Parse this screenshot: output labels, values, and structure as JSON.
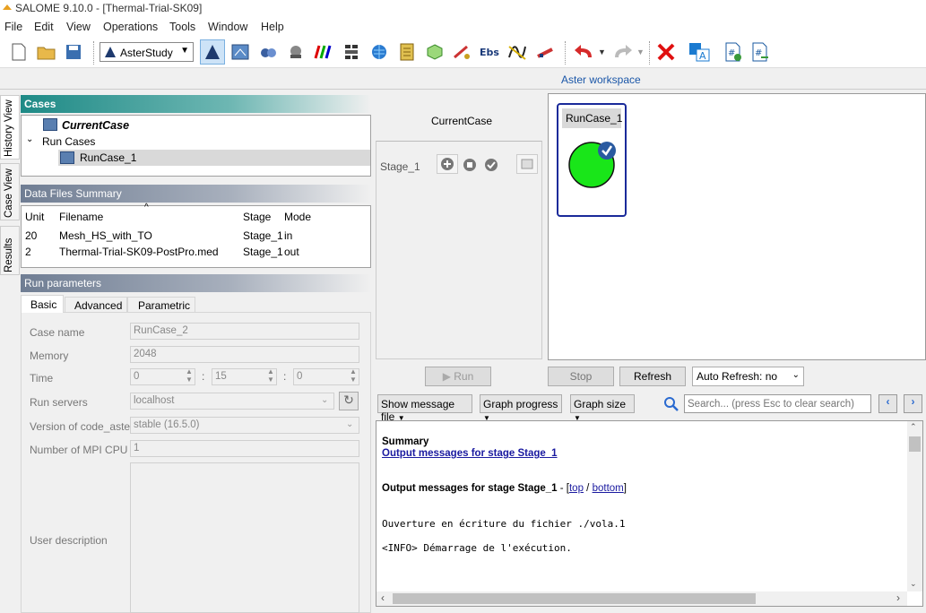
{
  "titlebar": {
    "title": "SALOME 9.10.0 - [Thermal-Trial-SK09]"
  },
  "menu": [
    "File",
    "Edit",
    "View",
    "Operations",
    "Tools",
    "Window",
    "Help"
  ],
  "toolbar": {
    "module": "AsterStudy"
  },
  "workspace_label": "Aster workspace",
  "vtabs": {
    "history": "History View",
    "case": "Case View",
    "results": "Results"
  },
  "cases": {
    "header": "Cases",
    "current": "CurrentCase",
    "run_cases": "Run Cases",
    "runcase": "RunCase_1"
  },
  "datafiles": {
    "header": "Data Files Summary",
    "columns": [
      "Unit",
      "Filename",
      "Stage",
      "Mode"
    ],
    "rows": [
      [
        "20",
        "Mesh_HS_with_TO",
        "Stage_1",
        "in"
      ],
      [
        "2",
        "Thermal-Trial-SK09-PostPro.med",
        "Stage_1",
        "out"
      ]
    ]
  },
  "runparams": {
    "header": "Run parameters",
    "tabs": [
      "Basic",
      "Advanced",
      "Parametric"
    ],
    "case_name_label": "Case name",
    "case_name": "RunCase_2",
    "memory_label": "Memory",
    "memory": "2048",
    "time_label": "Time",
    "time_h": "0",
    "time_m": "15",
    "time_s": "0",
    "servers_label": "Run servers",
    "servers": "localhost",
    "version_label": "Version of code_aster",
    "version": "stable (16.5.0)",
    "mpi_label": "Number of MPI CPU",
    "mpi": "1",
    "desc_label": "User description"
  },
  "stages": {
    "header": "CurrentCase",
    "stage": "Stage_1"
  },
  "graph": {
    "node": "RunCase_1"
  },
  "controls": {
    "run": "Run",
    "stop": "Stop",
    "refresh": "Refresh",
    "autorefresh": "Auto Refresh: no",
    "show_msg": "Show message file",
    "progress": "Graph progress",
    "size": "Graph size",
    "search_placeholder": "Search... (press Esc to clear search)"
  },
  "messages": {
    "summary": "Summary",
    "link": "Output messages for stage Stage_1",
    "heading": "Output messages for stage Stage_1",
    "sep": " - [",
    "top": "top",
    "slash": " / ",
    "bottom": "bottom",
    "close": "]",
    "line1": "Ouverture en écriture du fichier ./vola.1",
    "line2": "<INFO> Démarrage de l'exécution."
  }
}
